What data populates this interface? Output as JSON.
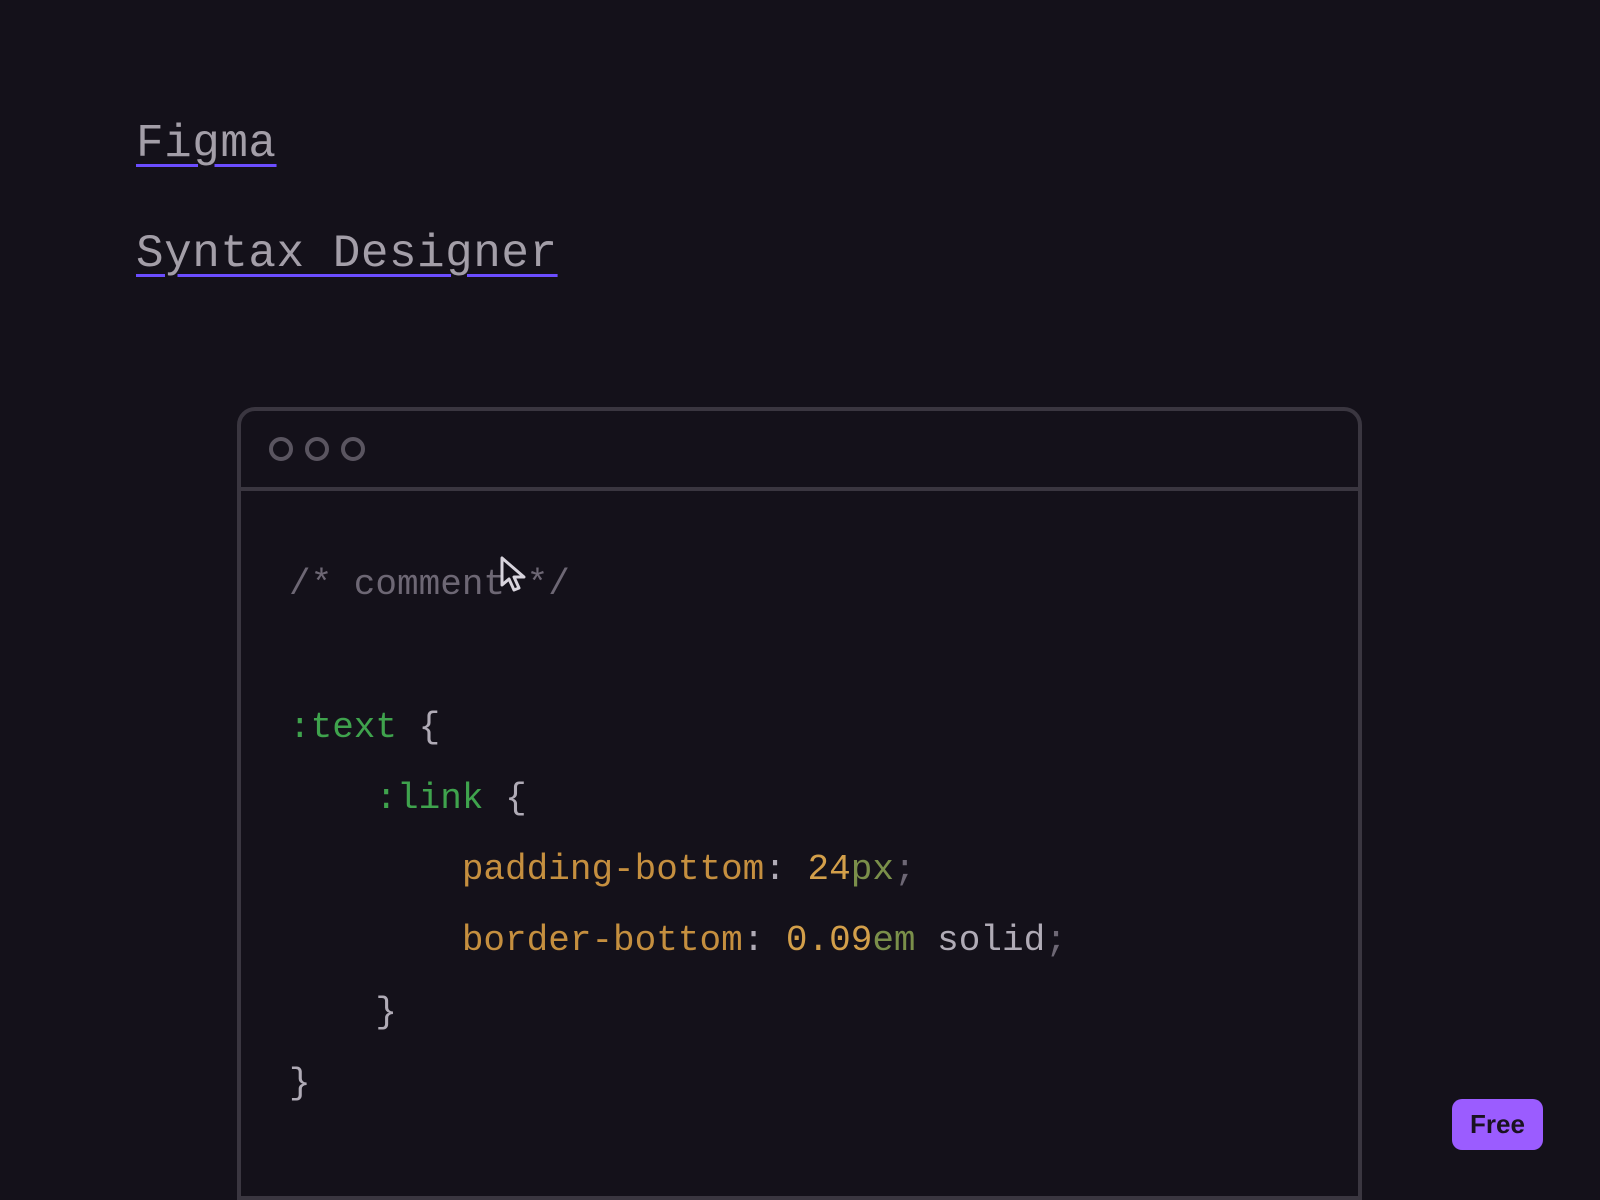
{
  "header": {
    "link1": "Figma",
    "link2": "Syntax Designer"
  },
  "badge": {
    "label": "Free"
  },
  "code": {
    "comment": "/* comment */",
    "selector1": ":text",
    "selector2": ":link",
    "brace_open": "{",
    "brace_close": "}",
    "prop1_name": "padding-bottom",
    "prop1_num": "24",
    "prop1_unit": "px",
    "prop2_name": "border-bottom",
    "prop2_num": "0.09",
    "prop2_unit": "em",
    "prop2_val": "solid",
    "colon": ":",
    "semicolon": ";",
    "indent1": "    ",
    "indent2": "        ",
    "space": " "
  }
}
